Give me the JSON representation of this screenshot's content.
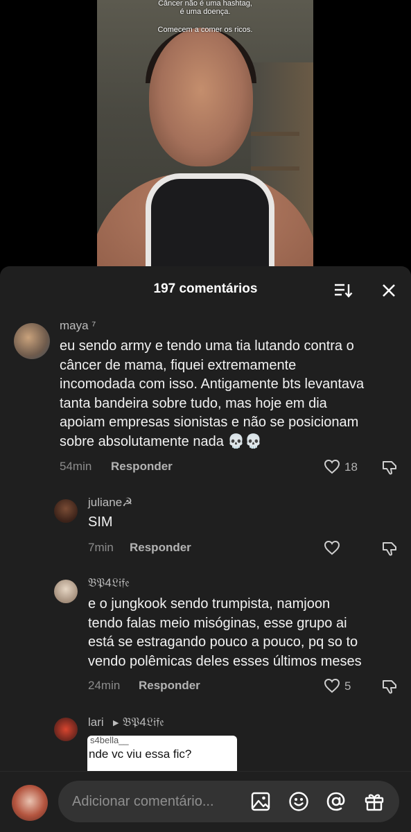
{
  "video": {
    "caption_lines": [
      "Câncer não é uma hashtag,",
      "é uma doença.",
      "Comecem a comer os ricos."
    ]
  },
  "comments_sheet": {
    "title": "197 comentários"
  },
  "comments": [
    {
      "username": "maya ⁷",
      "text_lines": [
        "eu sendo army e tendo uma tia lutando contra o",
        "câncer de mama, fiquei extremamente",
        "incomodada com isso. Antigamente bts levantava",
        "tanta bandeira sobre tudo, mas hoje em dia",
        "apoiam empresas sionistas e não se posicionam",
        "sobre absolutamente nada 💀💀"
      ],
      "time": "54min",
      "reply_label": "Responder",
      "likes": "18"
    },
    {
      "username": "juliane☭",
      "text_lines": [
        "SIM"
      ],
      "time": "7min",
      "reply_label": "Responder",
      "likes": ""
    },
    {
      "username": "𝔅𝔓4𝔏𝔦𝔣𝔢",
      "text_lines": [
        "e o jungkook sendo trumpista, namjoon",
        "tendo falas meio misóginas, esse grupo ai",
        "está se estragando pouco a pouco, pq so to",
        "vendo polêmicas deles esses últimos meses"
      ],
      "time": "24min",
      "reply_label": "Responder",
      "likes": "5"
    },
    {
      "username": "lari",
      "reply_to": "𝔅𝔓4𝔏𝔦𝔣𝔢",
      "quoted_name": "s4bella__",
      "quoted_text": "nde vc viu essa fic?"
    }
  ],
  "input": {
    "placeholder": "Adicionar comentário..."
  },
  "icons": {
    "sort": "sort-icon",
    "close": "close-icon",
    "heart": "heart-icon",
    "dislike": "dislike-icon",
    "image": "image-icon",
    "emoji": "emoji-icon",
    "mention": "at-icon",
    "gift": "gift-icon"
  },
  "colors": {
    "sheet_bg": "#1f1f1f",
    "input_bg": "#333333",
    "muted_text": "#8c8c8c"
  }
}
